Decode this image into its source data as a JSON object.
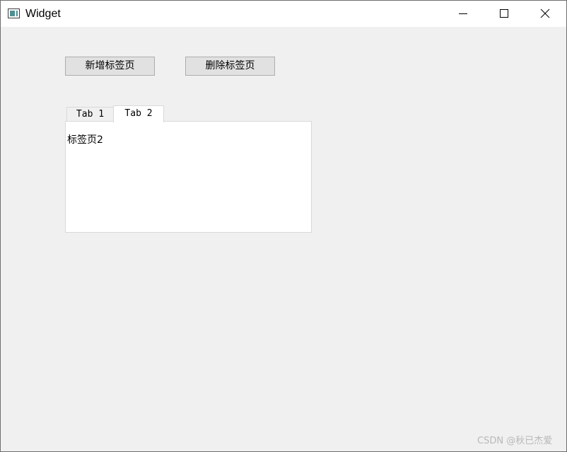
{
  "window": {
    "title": "Widget",
    "icon": "window-app-icon",
    "controls": {
      "minimize_icon": "minimize-icon",
      "maximize_icon": "maximize-icon",
      "close_icon": "close-icon"
    }
  },
  "toolbar": {
    "add_tab_label": "新增标签页",
    "remove_tab_label": "删除标签页"
  },
  "tabs": {
    "items": [
      {
        "label": "Tab 1",
        "selected": false
      },
      {
        "label": "Tab 2",
        "selected": true
      }
    ],
    "active_content": "标签页2"
  },
  "watermark": "CSDN @秋已杰爱",
  "colors": {
    "background": "#f0f0f0",
    "titlebar": "#ffffff",
    "button_face": "#e1e1e1",
    "button_border": "#adadad",
    "tab_border": "#d9d9d9"
  }
}
